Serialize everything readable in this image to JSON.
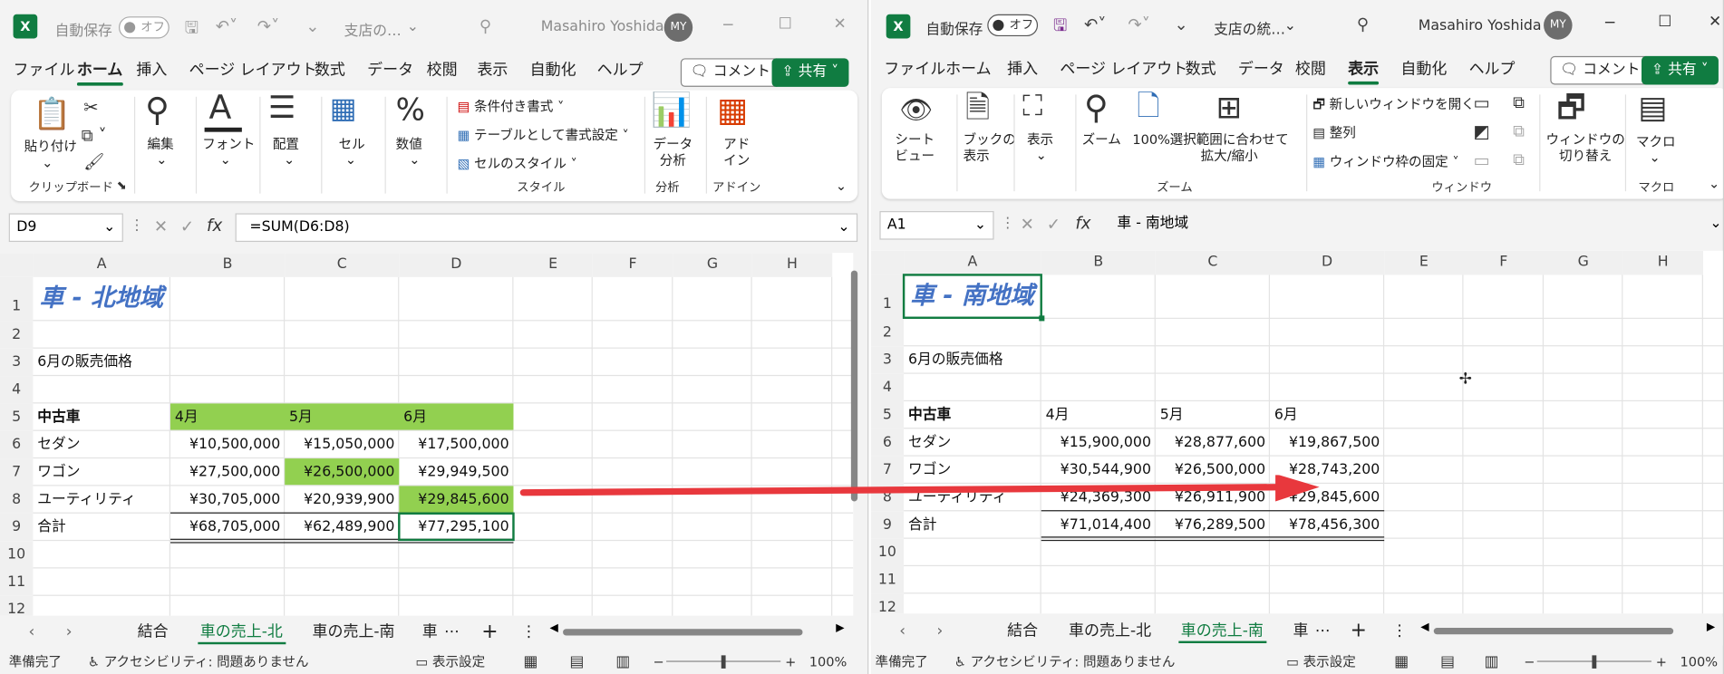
{
  "left": {
    "title": {
      "autosave": "自動保存",
      "toggle": "オフ",
      "filename": "支店の…",
      "user": "Masahiro Yoshida",
      "initials": "MY"
    },
    "menu": [
      "ファイル",
      "ホーム",
      "挿入",
      "ページ レイアウト",
      "数式",
      "データ",
      "校閲",
      "表示",
      "自動化",
      "ヘルプ"
    ],
    "comment": "コメント",
    "share": "共有",
    "ribbon": {
      "paste": "貼り付け",
      "clipboard": "クリップボード",
      "edit": "編集",
      "font": "フォント",
      "align": "配置",
      "cell": "セル",
      "number": "数値",
      "cond": "条件付き書式",
      "table": "テーブルとして書式設定",
      "cellstyle": "セルのスタイル",
      "style": "スタイル",
      "analysis_btn": "データ分析",
      "analysis": "分析",
      "addin_btn": "アドイン",
      "addin": "アドイン"
    },
    "namebox": "D9",
    "formula": "=SUM(D6:D8)",
    "cols": [
      "A",
      "B",
      "C",
      "D",
      "E",
      "F",
      "G",
      "H"
    ],
    "rows": [
      "1",
      "2",
      "3",
      "4",
      "5",
      "6",
      "7",
      "8",
      "9",
      "10",
      "11",
      "12"
    ],
    "cells": {
      "title": "車 - 北地域",
      "sub": "6月の販売価格",
      "h_a": "中古車",
      "h_b": "4月",
      "h_c": "5月",
      "h_d": "6月",
      "r6": [
        "セダン",
        "¥10,500,000",
        "¥15,050,000",
        "¥17,500,000"
      ],
      "r7": [
        "ワゴン",
        "¥27,500,000",
        "¥26,500,000",
        "¥29,949,500"
      ],
      "r8": [
        "ユーティリティ",
        "¥30,705,000",
        "¥20,939,900",
        "¥29,845,600"
      ],
      "r9": [
        "合計",
        "¥68,705,000",
        "¥62,489,900",
        "¥77,295,100"
      ]
    },
    "sheets": [
      "結合",
      "車の売上-北",
      "車の売上-南",
      "車"
    ],
    "status": {
      "ready": "準備完了",
      "access": "アクセシビリティ: 問題ありません",
      "disp": "表示設定",
      "zoom": "100%"
    }
  },
  "right": {
    "title": {
      "autosave": "自動保存",
      "toggle": "オフ",
      "filename": "支店の統…",
      "user": "Masahiro Yoshida",
      "initials": "MY"
    },
    "menu": [
      "ファイル",
      "ホーム",
      "挿入",
      "ページ レイアウト",
      "数式",
      "データ",
      "校閲",
      "表示",
      "自動化",
      "ヘルプ"
    ],
    "comment": "コメント",
    "share": "共有",
    "ribbon": {
      "sheetview": "シート\nビュー",
      "bookview": "ブックの\n表示",
      "show": "表示",
      "zoom_btn": "ズーム",
      "zoom100": "100%",
      "fit": "選択範囲に合わせて\n拡大/縮小",
      "zoom": "ズーム",
      "newwin": "新しいウィンドウを開く",
      "arrange": "整列",
      "freeze": "ウィンドウ枠の固定",
      "window": "ウィンドウ",
      "switch": "ウィンドウの\n切り替え",
      "macro_btn": "マクロ",
      "macro": "マクロ"
    },
    "namebox": "A1",
    "formula": "車 - 南地域",
    "cols": [
      "A",
      "B",
      "C",
      "D",
      "E",
      "F",
      "G",
      "H"
    ],
    "rows": [
      "1",
      "2",
      "3",
      "4",
      "5",
      "6",
      "7",
      "8",
      "9",
      "10",
      "11",
      "12"
    ],
    "cells": {
      "title": "車 - 南地域",
      "sub": "6月の販売価格",
      "h_a": "中古車",
      "h_b": "4月",
      "h_c": "5月",
      "h_d": "6月",
      "r6": [
        "セダン",
        "¥15,900,000",
        "¥28,877,600",
        "¥19,867,500"
      ],
      "r7": [
        "ワゴン",
        "¥30,544,900",
        "¥26,500,000",
        "¥28,743,200"
      ],
      "r8": [
        "ユーティリティ",
        "¥24,369,300",
        "¥26,911,900",
        "¥29,845,600"
      ],
      "r9": [
        "合計",
        "¥71,014,400",
        "¥76,289,500",
        "¥78,456,300"
      ]
    },
    "sheets": [
      "結合",
      "車の売上-北",
      "車の売上-南",
      "車"
    ],
    "status": {
      "ready": "準備完了",
      "access": "アクセシビリティ: 問題ありません",
      "disp": "表示設定",
      "zoom": "100%"
    }
  },
  "colors": {
    "excel_green": "#107c41",
    "highlight": "#92d050",
    "title_blue": "#4472c4",
    "arrow": "#e8383d"
  }
}
